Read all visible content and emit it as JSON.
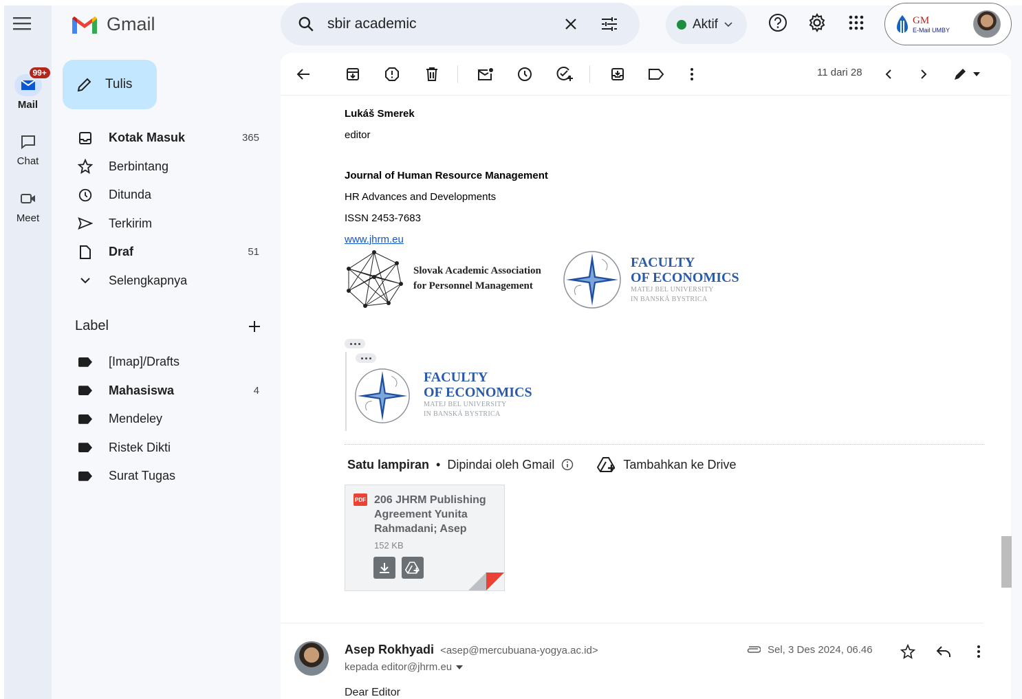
{
  "app": {
    "brand": "Gmail"
  },
  "rail": {
    "mail": {
      "label": "Mail",
      "badge": "99+"
    },
    "chat": {
      "label": "Chat"
    },
    "meet": {
      "label": "Meet"
    }
  },
  "compose": {
    "label": "Tulis"
  },
  "nav": [
    {
      "label": "Kotak Masuk",
      "count": "365",
      "icon": "inbox-icon",
      "bold": true
    },
    {
      "label": "Berbintang",
      "count": "",
      "icon": "star-icon",
      "bold": false
    },
    {
      "label": "Ditunda",
      "count": "",
      "icon": "clock-icon",
      "bold": false
    },
    {
      "label": "Terkirim",
      "count": "",
      "icon": "send-icon",
      "bold": false
    },
    {
      "label": "Draf",
      "count": "51",
      "icon": "draft-icon",
      "bold": true
    },
    {
      "label": "Selengkapnya",
      "count": "",
      "icon": "chevron-down-icon",
      "bold": false
    }
  ],
  "labels": {
    "heading": "Label",
    "items": [
      {
        "label": "[Imap]/Drafts",
        "count": ""
      },
      {
        "label": "Mahasiswa",
        "count": "4"
      },
      {
        "label": "Mendeley",
        "count": ""
      },
      {
        "label": "Ristek Dikti",
        "count": ""
      },
      {
        "label": "Surat Tugas",
        "count": ""
      }
    ]
  },
  "search": {
    "query": "sbir academic"
  },
  "status": {
    "label": "Aktif",
    "color": "#1e8e3e"
  },
  "account": {
    "org_logo_text": "GM",
    "org_logo_sub": "E-Mail UMBY"
  },
  "toolbar": {
    "pager": "11 dari 28"
  },
  "message": {
    "sig_name": "Lukáš Smerek",
    "sig_role": "editor",
    "journal": "Journal of Human Resource Management",
    "tagline": "HR Advances and Developments",
    "issn": "ISSN 2453-7683",
    "url": "www.jhrm.eu",
    "saapm_line1": "Slovak Academic Association",
    "saapm_line2": "for Personnel Management",
    "foe_line1": "FACULTY",
    "foe_line2": "OF ECONOMICS",
    "foe_sub1": "MATEJ BEL UNIVERSITY",
    "foe_sub2": "IN BANSKÁ BYSTRICA"
  },
  "attachments": {
    "heading": "Satu lampiran",
    "scanned": "Dipindai oleh Gmail",
    "add_drive": "Tambahkan ke Drive",
    "file": {
      "type": "PDF",
      "name": "206 JHRM Publishing Agreement Yunita Rahmadani; Asep",
      "size": "152 KB"
    }
  },
  "next_message": {
    "sender": "Asep Rokhyadi",
    "email": "<asep@mercubuana-yogya.ac.id>",
    "to": "kepada editor@jhrm.eu",
    "date": "Sel, 3 Des 2024, 06.46",
    "greeting": "Dear Editor"
  },
  "colors": {
    "accent": "#c2e7ff",
    "badge": "#b3261e",
    "link": "#1155cc",
    "faculty_blue": "#2a5aa8"
  }
}
